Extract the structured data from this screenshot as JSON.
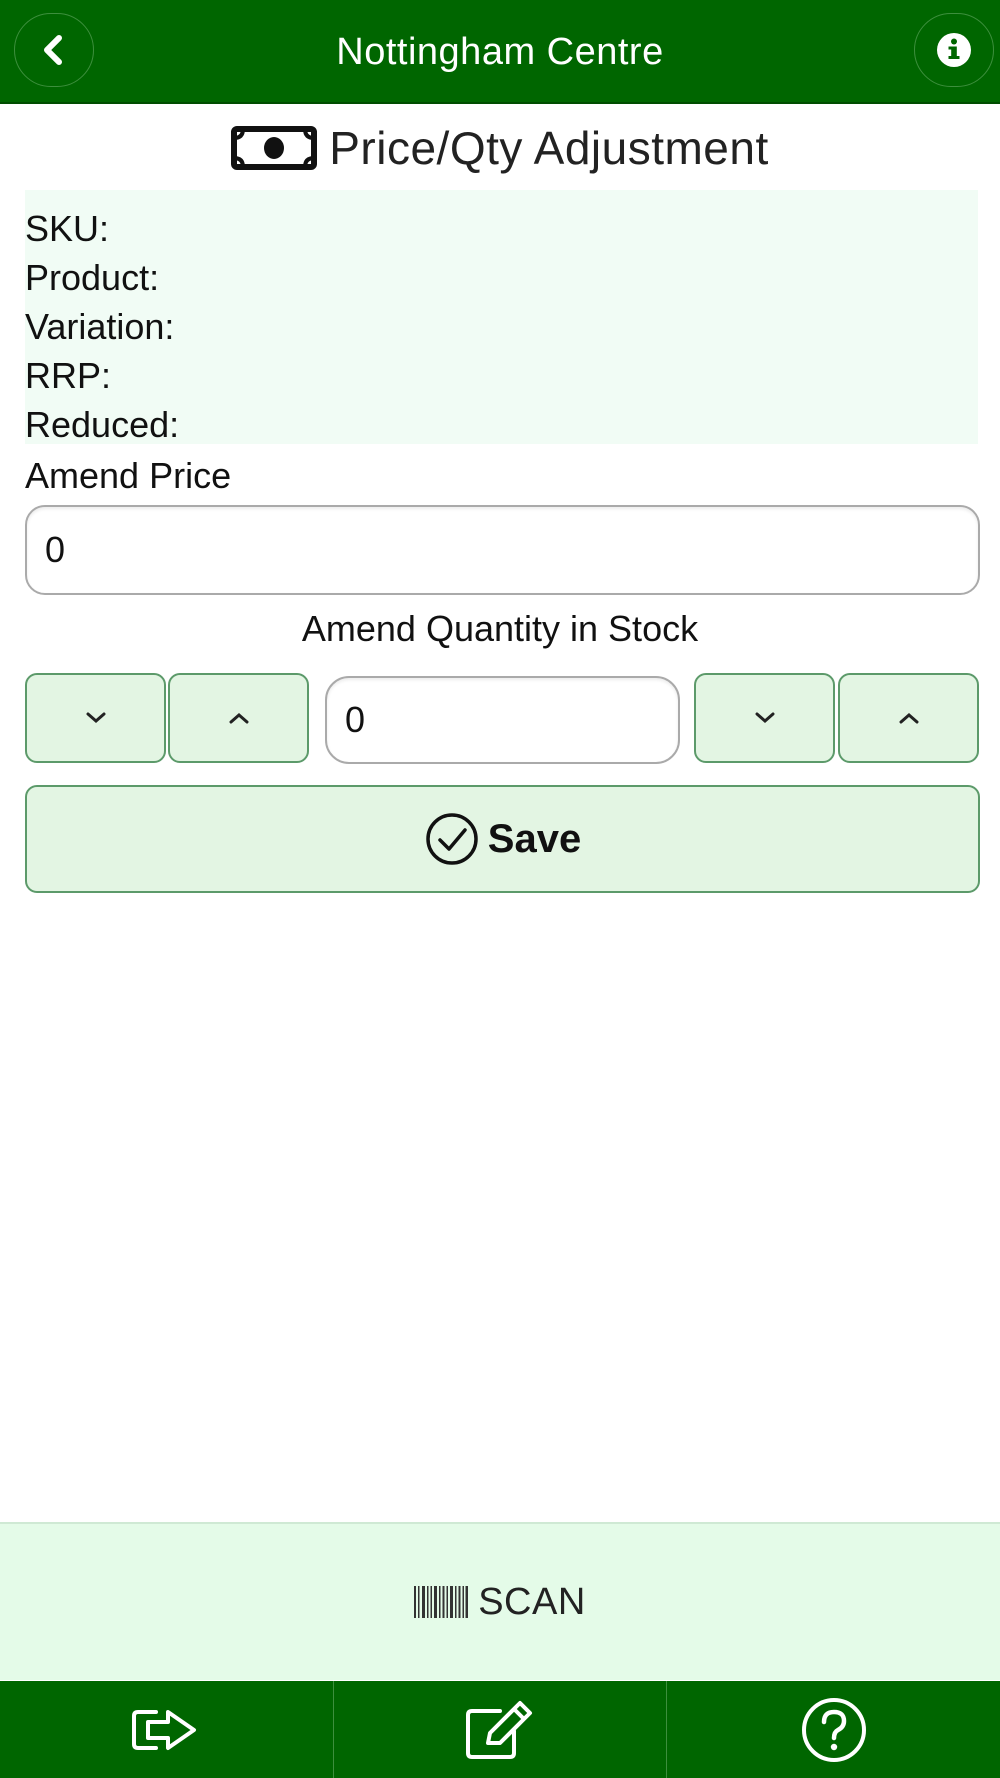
{
  "header": {
    "title": "Nottingham Centre",
    "back_icon": "chevron-left-icon",
    "info_icon": "info-icon"
  },
  "page": {
    "title": "Price/Qty Adjustment",
    "title_icon": "money-icon"
  },
  "info_panel": {
    "rows": [
      "SKU:",
      "Product:",
      "Variation:",
      "RRP:",
      "Reduced:"
    ]
  },
  "price": {
    "label": "Amend Price",
    "value": "0"
  },
  "quantity": {
    "label": "Amend Quantity in Stock",
    "value": "0"
  },
  "save": {
    "label": "Save",
    "icon": "check-circle-icon"
  },
  "scan": {
    "label": "SCAN",
    "icon": "barcode-icon"
  },
  "footer": {
    "icons": [
      "logout-icon",
      "edit-icon",
      "help-icon"
    ]
  },
  "colors": {
    "brand_green": "#006600",
    "button_bg": "#e3f5e3",
    "panel_bg": "#f1fcf5",
    "scan_bg": "#e4fbe8"
  }
}
